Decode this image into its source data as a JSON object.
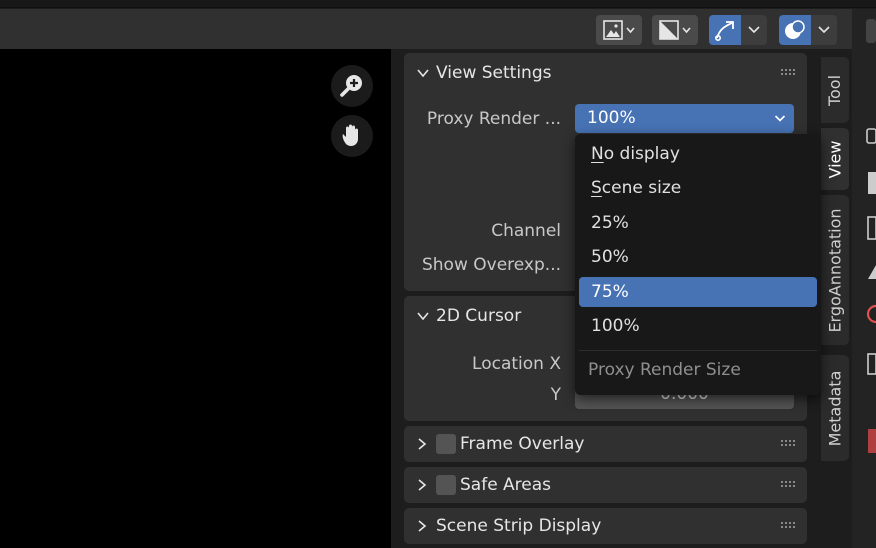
{
  "header": {
    "buttons": [
      {
        "icon": "image-display-icon"
      },
      {
        "icon": "image-channel-icon"
      },
      {
        "icon": "gizmo-icon"
      },
      {
        "icon": "overlay-icon"
      }
    ]
  },
  "preview": {
    "zoom_icon": "zoom-in-icon",
    "pan_icon": "hand-icon"
  },
  "panels": {
    "view_settings": {
      "title": "View Settings",
      "proxy_label": "Proxy Render ...",
      "proxy_value": "100%",
      "channel_label": "Channel",
      "show_overexposed_label": "Show Overexp..."
    },
    "cursor_2d": {
      "title": "2D Cursor",
      "location_x_label": "Location X",
      "y_label": "Y",
      "y_value": "0.000"
    },
    "frame_overlay": {
      "title": "Frame Overlay"
    },
    "safe_areas": {
      "title": "Safe Areas"
    },
    "scene_strip_display": {
      "title": "Scene Strip Display"
    }
  },
  "dropdown": {
    "items": [
      {
        "label": "No display",
        "ul": "N",
        "rest": "o display"
      },
      {
        "label": "Scene size",
        "ul": "S",
        "rest": "cene size"
      },
      {
        "label": "25%"
      },
      {
        "label": "50%"
      },
      {
        "label": "75%"
      },
      {
        "label": "100%"
      }
    ],
    "selected_index": 4,
    "title": "Proxy Render Size"
  },
  "tabs": [
    {
      "label": "Tool"
    },
    {
      "label": "View"
    },
    {
      "label": "ErgoAnnotation"
    },
    {
      "label": "Metadata"
    }
  ],
  "colors": {
    "accent": "#4772b3",
    "panel": "#303030",
    "background": "#1d1d1d"
  }
}
